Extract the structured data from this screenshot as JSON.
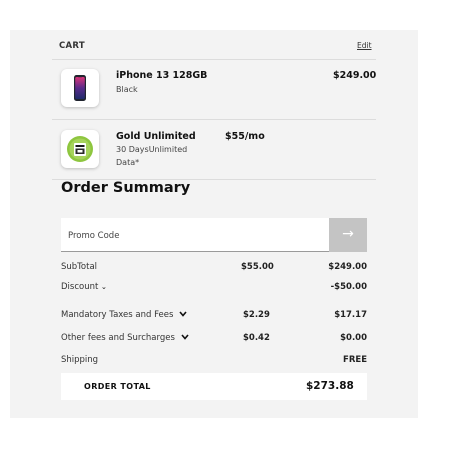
{
  "cart": {
    "title": "CART",
    "edit_label": "Edit",
    "items": [
      {
        "name": "iPhone 13 128GB",
        "subtitle": "Black",
        "price": "$249.00",
        "icon": "phone-icon"
      },
      {
        "name": "Gold Unlimited",
        "subtitle_1": "30 DaysUnlimited",
        "subtitle_2": "Data*",
        "price": "$55/mo",
        "icon": "plan-badge-icon"
      }
    ]
  },
  "summary": {
    "title": "Order Summary",
    "promo_placeholder": "Promo Code",
    "promo_button_icon": "→",
    "rows": {
      "subtotal": {
        "label": "SubTotal",
        "monthly": "$55.00",
        "onetime": "$249.00"
      },
      "discount": {
        "label": "Discount",
        "onetime": "-$50.00"
      },
      "taxes": {
        "label": "Mandatory Taxes and Fees",
        "monthly": "$2.29",
        "onetime": "$17.17"
      },
      "other_fees": {
        "label": "Other fees and Surcharges",
        "monthly": "$0.42",
        "onetime": "$0.00"
      },
      "shipping": {
        "label": "Shipping",
        "onetime": "FREE"
      }
    },
    "order_total_label": "ORDER TOTAL",
    "order_total_value": "$273.88"
  },
  "colors": {
    "panel_bg": "#f3f3f3",
    "accent_green": "#8ec63f",
    "promo_button": "#c4c4c4"
  }
}
